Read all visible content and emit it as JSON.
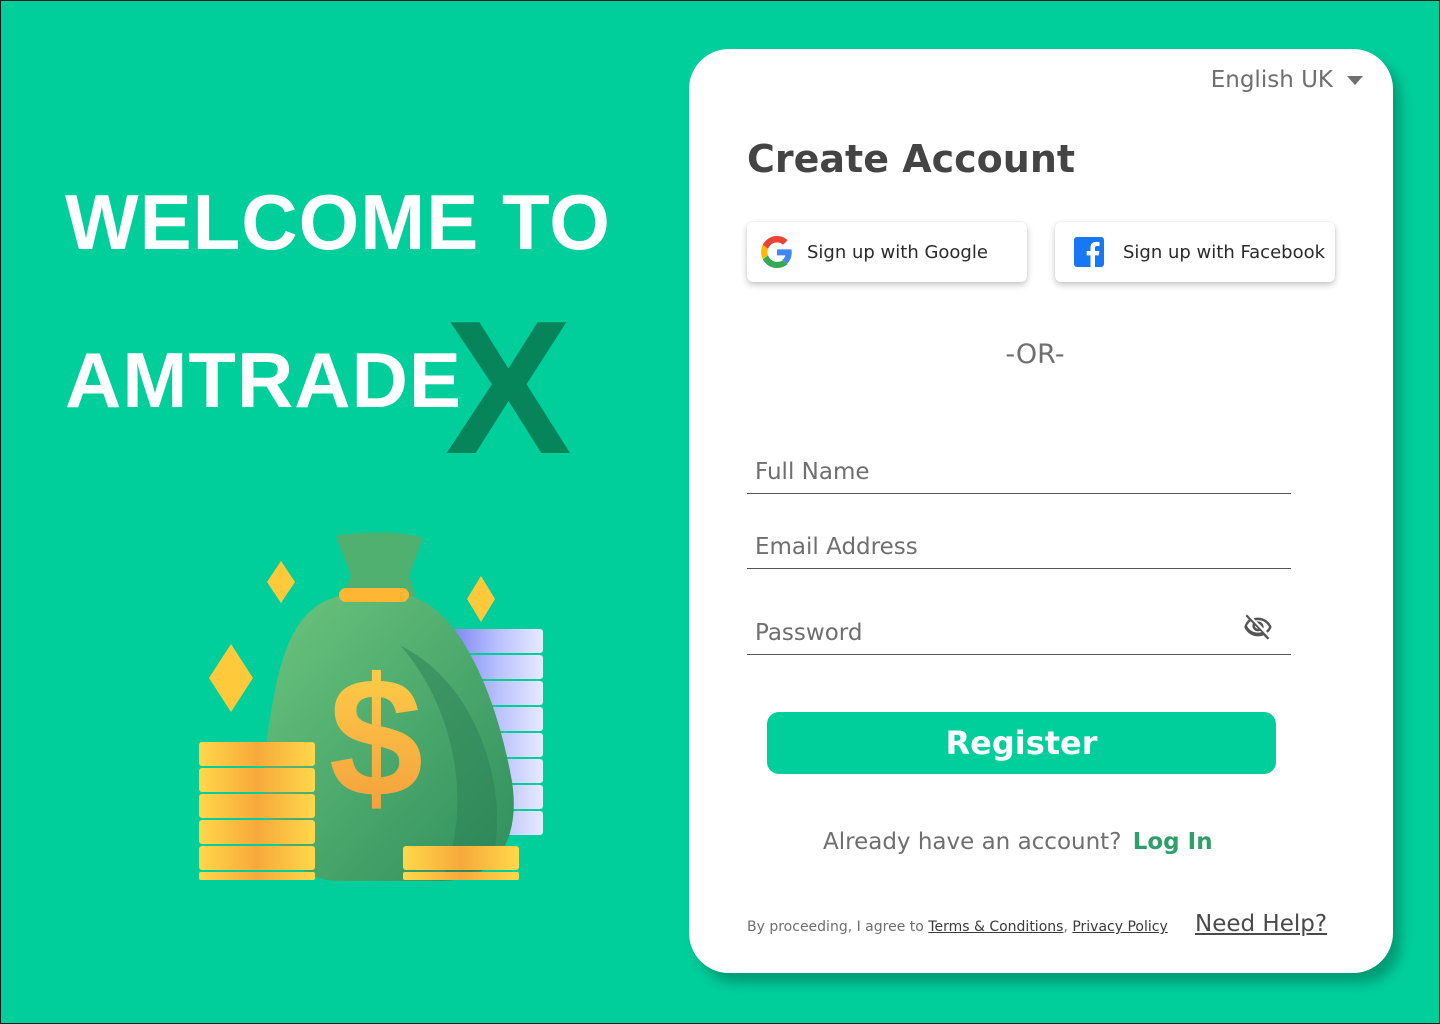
{
  "hero": {
    "line1": "WELCOME TO",
    "line2": "AMTRADE",
    "accent_letter": "X"
  },
  "colors": {
    "background": "#00CF9C",
    "accent_dark": "#06845A",
    "link_green": "#2E9E6B",
    "card": "#FFFFFF"
  },
  "language": {
    "selected": "English UK"
  },
  "form": {
    "title": "Create Account",
    "google_label": "Sign up with Google",
    "facebook_label": "Sign up with Facebook",
    "divider": "-OR-",
    "full_name_placeholder": "Full Name",
    "email_placeholder": "Email Address",
    "password_placeholder": "Password",
    "register_label": "Register",
    "login_prompt": "Already have an account?",
    "login_link": "Log In",
    "legal_prefix": "By proceeding, I agree to ",
    "terms_link": "Terms & Conditions",
    "legal_sep": ", ",
    "privacy_link": "Privacy Policy",
    "help_link": "Need Help?"
  },
  "icons": {
    "google": "google-logo-icon",
    "facebook": "facebook-logo-icon",
    "password_toggle": "eye-slash-icon",
    "language_caret": "caret-down-icon",
    "illustration": "money-bag-coins-illustration"
  }
}
